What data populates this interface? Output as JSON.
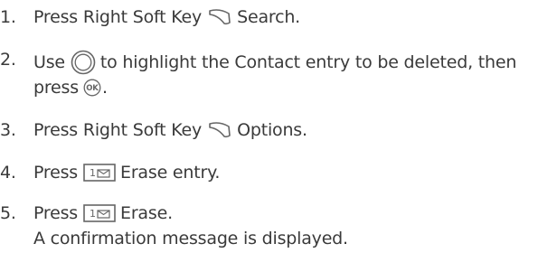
{
  "steps": [
    {
      "number": "1.",
      "prefix": "Press Right Soft Key",
      "icon": "right-soft-key-icon",
      "suffix": "Search."
    },
    {
      "number": "2.",
      "prefix": "Use",
      "icon": "navigation-key-icon",
      "middle": "to highlight the Contact entry to be deleted, then",
      "line2_prefix": "press",
      "icon2": "ok-key-icon",
      "line2_suffix": "."
    },
    {
      "number": "3.",
      "prefix": "Press Right Soft Key",
      "icon": "right-soft-key-icon",
      "suffix": "Options."
    },
    {
      "number": "4.",
      "prefix": "Press",
      "icon": "key-1-icon",
      "suffix": "Erase entry."
    },
    {
      "number": "5.",
      "prefix": "Press",
      "icon": "key-1-icon",
      "suffix": "Erase.",
      "note": "A confirmation message is displayed."
    }
  ],
  "icon_labels": {
    "ok": "OK",
    "key1": "1"
  },
  "colors": {
    "text": "#3a3a3a",
    "icon": "#666666"
  }
}
